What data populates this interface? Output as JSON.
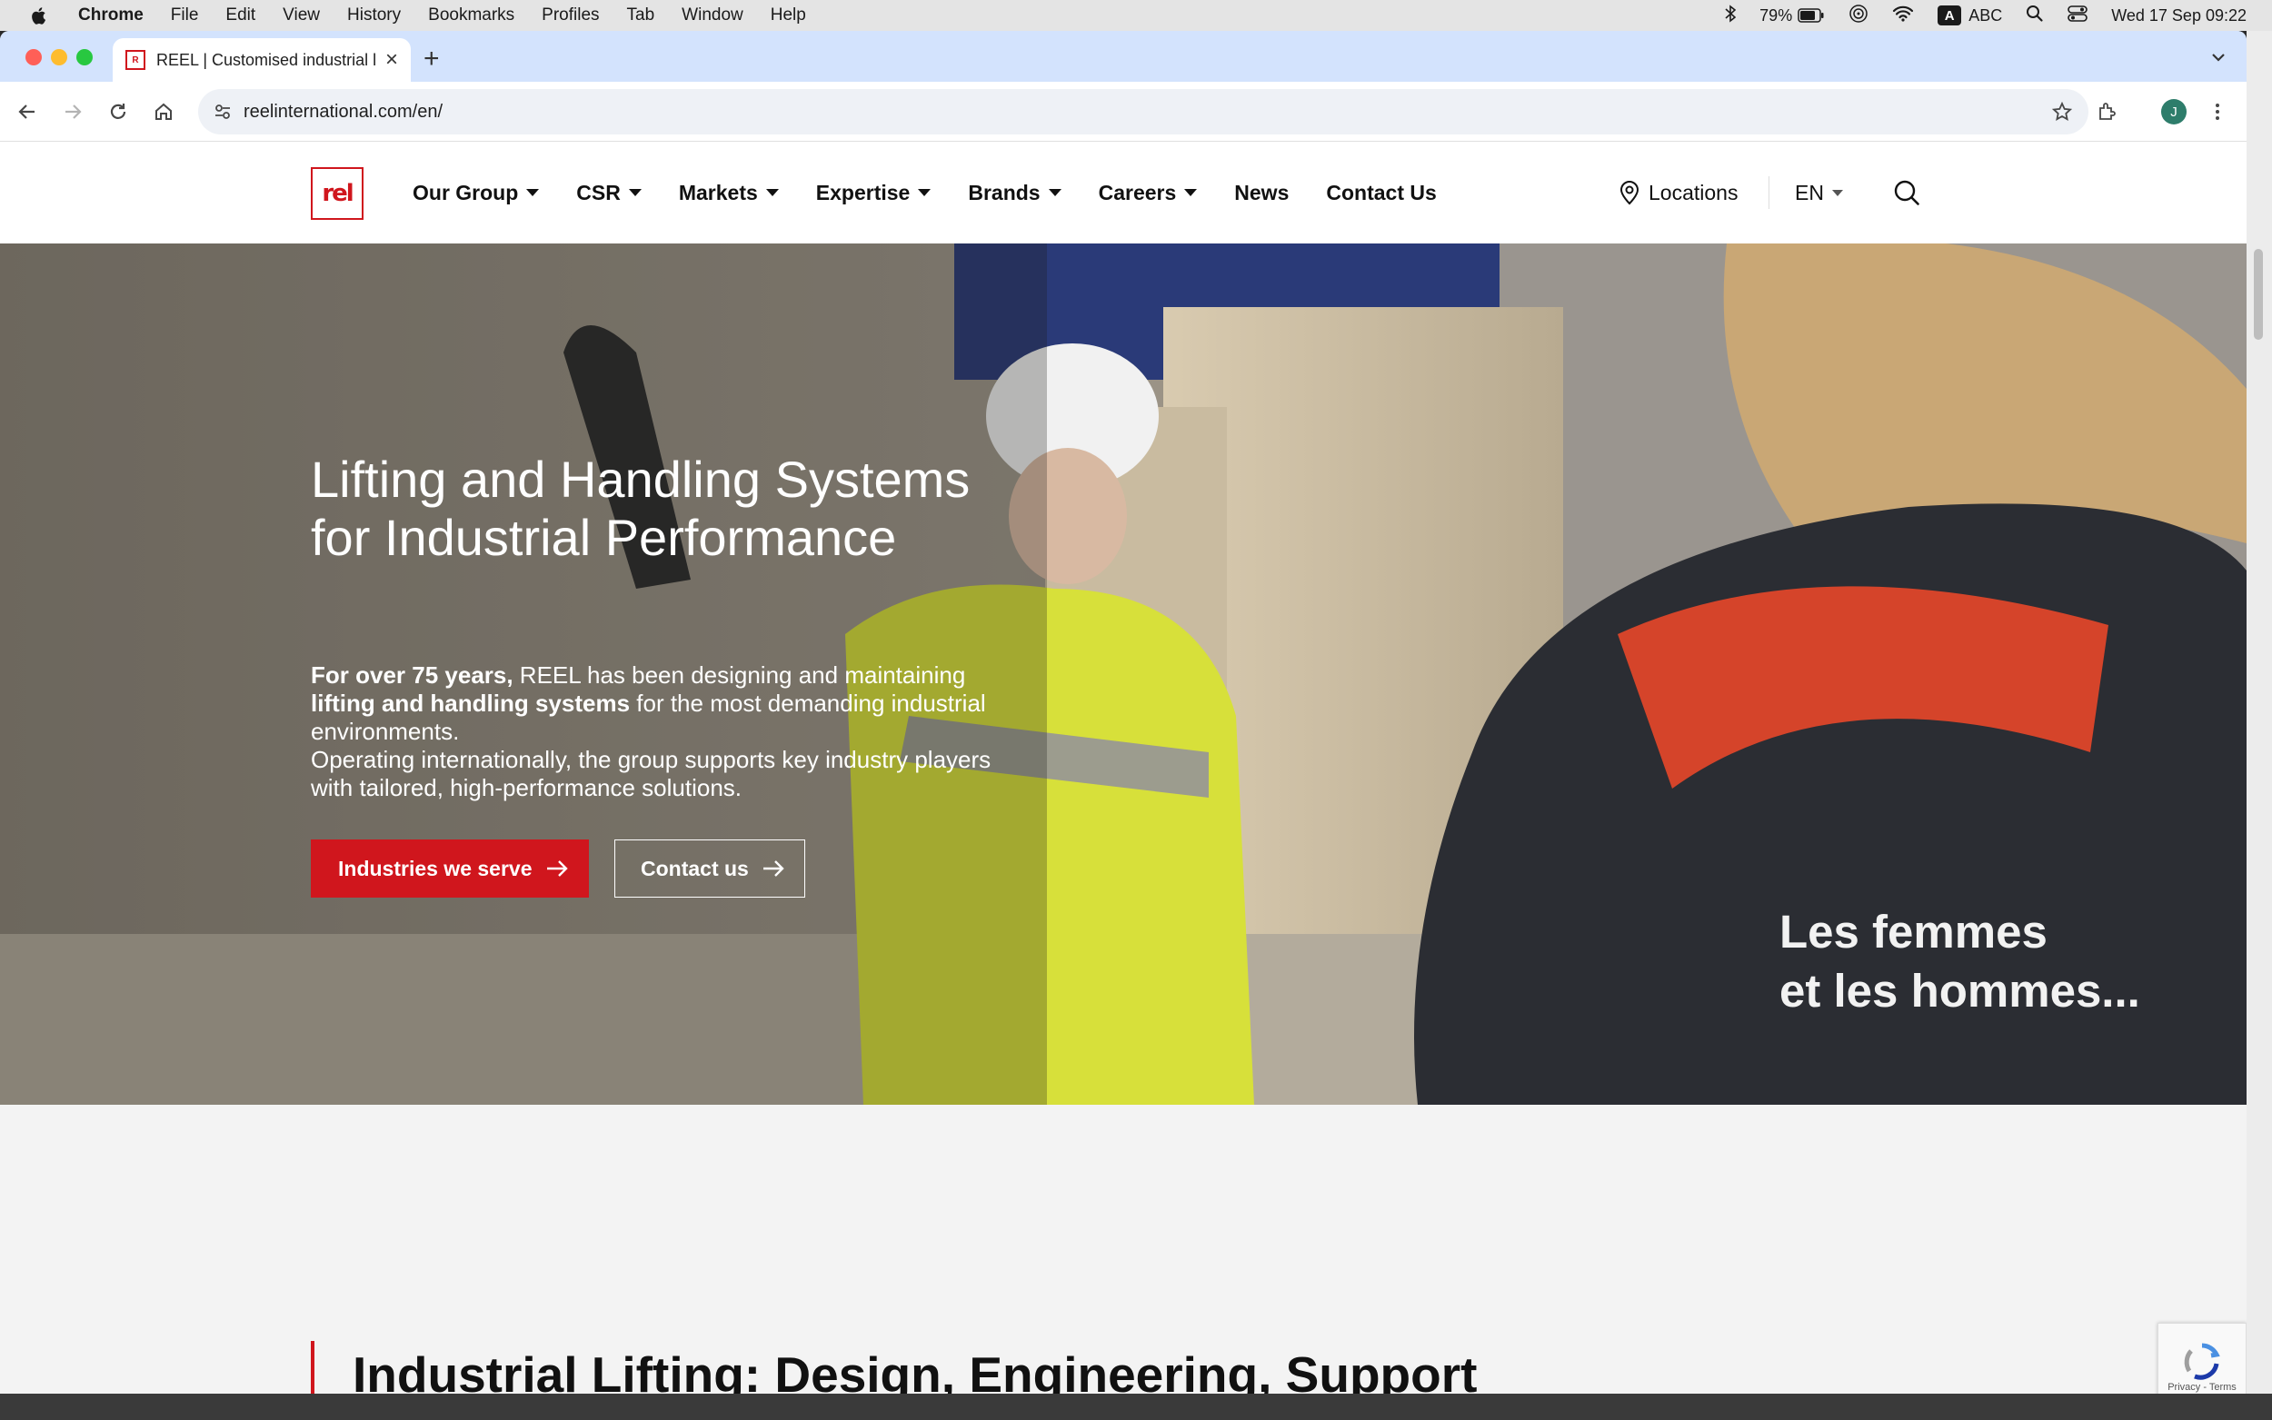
{
  "menubar": {
    "app": "Chrome",
    "items": [
      "File",
      "Edit",
      "View",
      "History",
      "Bookmarks",
      "Profiles",
      "Tab",
      "Window",
      "Help"
    ],
    "battery": "79%",
    "input_source": "ABC",
    "datetime": "Wed 17 Sep  09:22"
  },
  "browser": {
    "tab_title": "REEL | Customised industrial l",
    "url": "reelinternational.com/en/",
    "profile_initial": "J"
  },
  "site": {
    "logo_text": "rel",
    "nav": [
      "Our Group",
      "CSR",
      "Markets",
      "Expertise",
      "Brands",
      "Careers",
      "News",
      "Contact Us"
    ],
    "locations_label": "Locations",
    "language": "EN"
  },
  "hero": {
    "title": "Lifting and Handling Systems for Industrial Performance",
    "text": {
      "bold1": "For over 75 years,",
      "part1": " REEL has been designing and maintaining ",
      "bold2": "lifting and handling systems",
      "part2": " for the most demanding industrial environments.",
      "line2": "Operating internationally, the group supports key industry players with tailored, high-performance solutions."
    },
    "primary_button": "Industries we serve",
    "secondary_button": "Contact us",
    "video_caption_line1": "Les femmes",
    "video_caption_line2": "et les hommes..."
  },
  "section": {
    "title": "Industrial Lifting: Design, Engineering, Support"
  },
  "recaptcha": "Privacy - Terms",
  "colors": {
    "brand_red": "#d0161d",
    "tab_strip": "#d3e3fd"
  }
}
